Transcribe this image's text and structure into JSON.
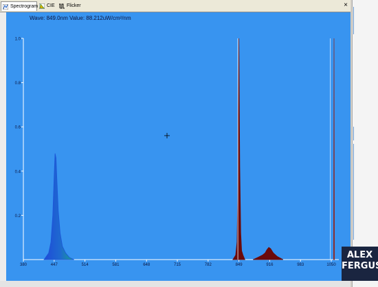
{
  "tabs": [
    {
      "label": "Spectrogram",
      "icon": "spectrogram-icon"
    },
    {
      "label": "CIE",
      "icon": "cie-icon"
    },
    {
      "label": "Flicker",
      "icon": "flicker-icon"
    }
  ],
  "window": {
    "close_label": "×"
  },
  "readout": "Wave: 849.0nm Value: 88.212uW/cm²/nm",
  "logo": {
    "line1": "ALEX",
    "line2": "FERGUS"
  },
  "colors": {
    "plot_bg": "#3894f0",
    "blue_peak_top": "#1f4bd8",
    "blue_peak_base": "#1aa38c",
    "red_peak": "#6b0a0a",
    "axis_text": "#0d1640"
  },
  "chart_data": {
    "type": "area",
    "x_ticks": [
      "380",
      "447",
      "514",
      "581",
      "648",
      "715",
      "782",
      "849",
      "916",
      "983",
      "1050"
    ],
    "y_ticks": [
      "1.0",
      "0.8",
      "0.6",
      "0.4",
      "0.2"
    ],
    "xlim": [
      380,
      1070
    ],
    "ylim": [
      0,
      1.0
    ],
    "grid": false,
    "series": [
      {
        "x": [
          425,
          435,
          440,
          444,
          447,
          449,
          451,
          453,
          456,
          460,
          465,
          472,
          480,
          490
        ],
        "y": [
          0,
          0.03,
          0.08,
          0.2,
          0.38,
          0.48,
          0.46,
          0.36,
          0.22,
          0.12,
          0.06,
          0.03,
          0.01,
          0
        ]
      },
      {
        "x": [
          836,
          842,
          845,
          847,
          849,
          851,
          853,
          855,
          858,
          862
        ],
        "y": [
          0,
          0.02,
          0.08,
          0.35,
          1.0,
          0.42,
          0.12,
          0.04,
          0.02,
          0
        ]
      },
      {
        "x": [
          880,
          890,
          900,
          906,
          910,
          914,
          918,
          924,
          932,
          945
        ],
        "y": [
          0,
          0.01,
          0.02,
          0.03,
          0.045,
          0.055,
          0.05,
          0.03,
          0.015,
          0
        ]
      },
      {
        "x": [
          1055,
          1056,
          1057
        ],
        "y": [
          0,
          1.0,
          0
        ]
      }
    ]
  }
}
